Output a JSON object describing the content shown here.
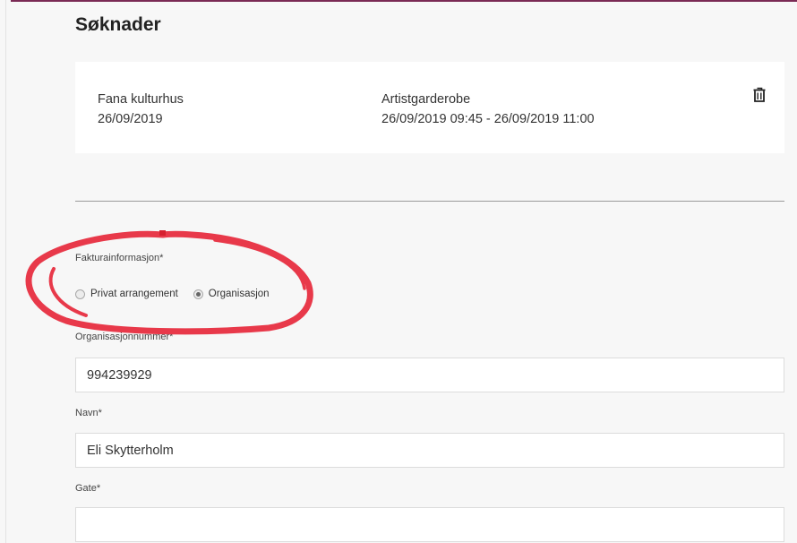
{
  "page": {
    "title": "Søknader"
  },
  "application": {
    "venue": "Fana kulturhus",
    "date": "26/09/2019",
    "room": "Artistgarderobe",
    "time_range": "26/09/2019 09:45 - 26/09/2019 11:00",
    "delete_icon": "trash-icon"
  },
  "form": {
    "billing_label": "Fakturainformasjon*",
    "billing_options": [
      {
        "label": "Privat arrangement",
        "selected": false
      },
      {
        "label": "Organisasjon",
        "selected": true
      }
    ],
    "org_number_label": "Organisasjonnummer*",
    "org_number_value": "994239929",
    "name_label": "Navn*",
    "name_value": "Eli Skytterholm",
    "street_label": "Gate*",
    "street_value": ""
  },
  "colors": {
    "accent_top": "#7a2a55",
    "annotation": "#e8394a"
  }
}
